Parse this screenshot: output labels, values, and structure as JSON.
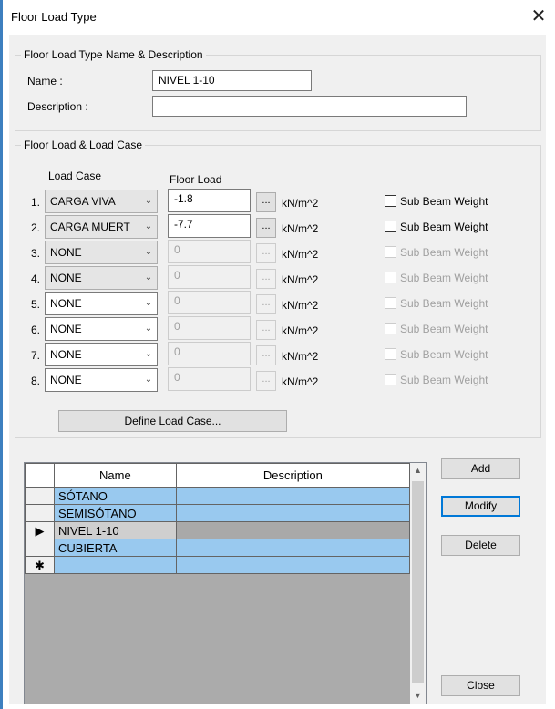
{
  "window": {
    "title": "Floor Load Type",
    "close_glyph": "✕"
  },
  "name_group": {
    "label": "Floor Load Type Name & Description",
    "name_label": "Name :",
    "name_value": "NIVEL 1-10",
    "description_label": "Description :",
    "description_value": ""
  },
  "load_group": {
    "label": "Floor Load & Load Case",
    "load_case_header": "Load Case",
    "floor_load_header": "Floor Load",
    "ellipsis": "...",
    "rows": [
      {
        "num": "1.",
        "load_case": "CARGA VIVA",
        "value": "-1.8",
        "unit": "kN/m^2",
        "checkbox_label": "Sub Beam Weight"
      },
      {
        "num": "2.",
        "load_case": "CARGA MUERT",
        "value": "-7.7",
        "unit": "kN/m^2",
        "checkbox_label": "Sub Beam Weight"
      },
      {
        "num": "3.",
        "load_case": "NONE",
        "value": "0",
        "unit": "kN/m^2",
        "checkbox_label": "Sub Beam Weight"
      },
      {
        "num": "4.",
        "load_case": "NONE",
        "value": "0",
        "unit": "kN/m^2",
        "checkbox_label": "Sub Beam Weight"
      },
      {
        "num": "5.",
        "load_case": "NONE",
        "value": "0",
        "unit": "kN/m^2",
        "checkbox_label": "Sub Beam Weight"
      },
      {
        "num": "6.",
        "load_case": "NONE",
        "value": "0",
        "unit": "kN/m^2",
        "checkbox_label": "Sub Beam Weight"
      },
      {
        "num": "7.",
        "load_case": "NONE",
        "value": "0",
        "unit": "kN/m^2",
        "checkbox_label": "Sub Beam Weight"
      },
      {
        "num": "8.",
        "load_case": "NONE",
        "value": "0",
        "unit": "kN/m^2",
        "checkbox_label": "Sub Beam Weight"
      }
    ],
    "define_button": "Define Load Case..."
  },
  "table": {
    "columns": [
      "Name",
      "Description"
    ],
    "rows": [
      {
        "marker": "",
        "name": "SÓTANO",
        "description": ""
      },
      {
        "marker": "",
        "name": "SEMISÓTANO",
        "description": ""
      },
      {
        "marker": "▶",
        "name": "NIVEL 1-10",
        "description": ""
      },
      {
        "marker": "",
        "name": "CUBIERTA",
        "description": ""
      },
      {
        "marker": "✱",
        "name": "",
        "description": ""
      }
    ],
    "scroll_up": "▲",
    "scroll_down": "▼"
  },
  "buttons": {
    "add": "Add",
    "modify": "Modify",
    "delete": "Delete",
    "close": "Close"
  },
  "colors": {
    "selection": "#99c9ef",
    "current_row": "#a9a9a9",
    "accent": "#0078d7"
  }
}
